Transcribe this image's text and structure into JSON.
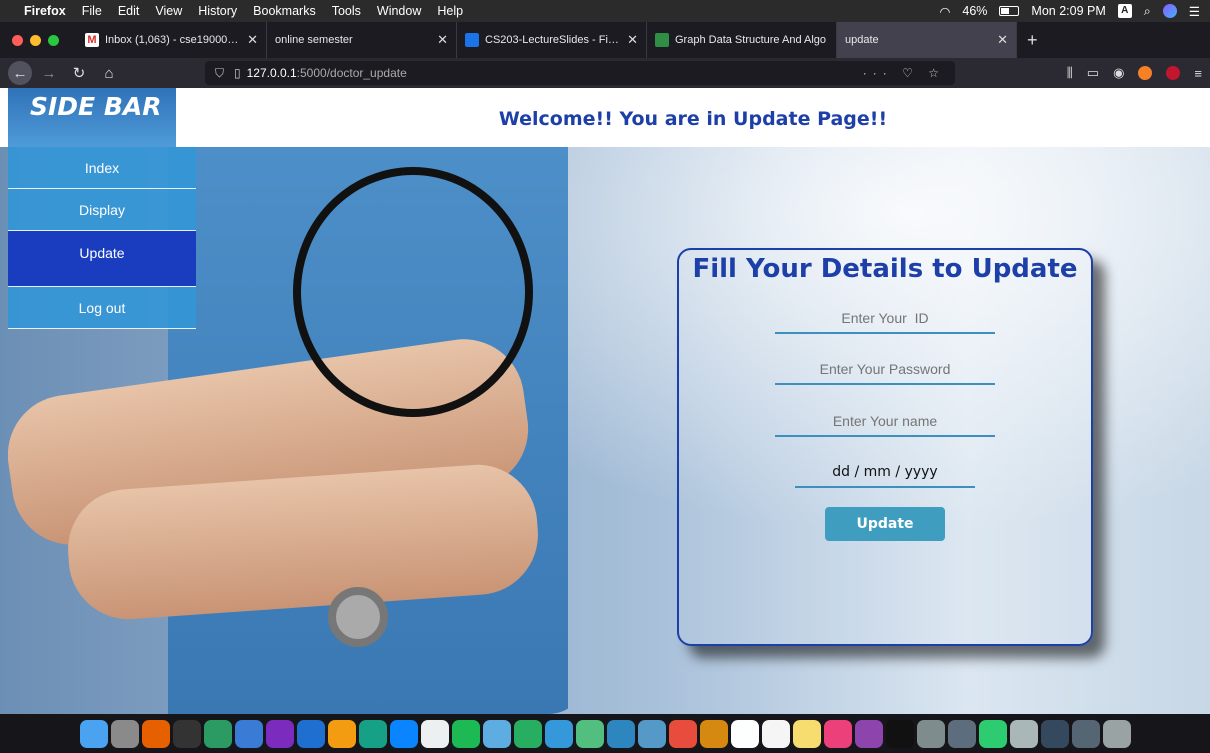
{
  "menubar": {
    "app": "Firefox",
    "items": [
      "File",
      "Edit",
      "View",
      "History",
      "Bookmarks",
      "Tools",
      "Window",
      "Help"
    ],
    "battery": "46%",
    "clock": "Mon 2:09 PM",
    "input_badge": "A"
  },
  "tabs": [
    {
      "label": "Inbox (1,063) - cse190001041",
      "icon_color": "#d93025"
    },
    {
      "label": "online semester",
      "icon_color": ""
    },
    {
      "label": "CS203-LectureSlides - Files -",
      "icon_color": "#1a73e8"
    },
    {
      "label": "Graph Data Structure And Algo",
      "icon_color": "#2f8d46"
    },
    {
      "label": "update",
      "icon_color": ""
    }
  ],
  "urlbar": {
    "host": "127.0.0.1",
    "path": ":5000/doctor_update"
  },
  "page": {
    "sidebar_title": "SIDE BAR",
    "welcome": "Welcome!! You are in Update Page!!",
    "sidebar_items": [
      "Index",
      "Display",
      "Update",
      "Log out"
    ],
    "form": {
      "title": "Fill Your Details to Update",
      "id_placeholder": "Enter Your  ID",
      "password_placeholder": "Enter Your Password",
      "name_placeholder": "Enter Your name",
      "date_placeholder": "dd / mm / yyyy",
      "submit_label": "Update"
    }
  },
  "colors": {
    "accent": "#1d3fa8",
    "sidebar": "#3496d6",
    "sidebar_active": "#1a3dbf",
    "button": "#3f9dbf"
  }
}
